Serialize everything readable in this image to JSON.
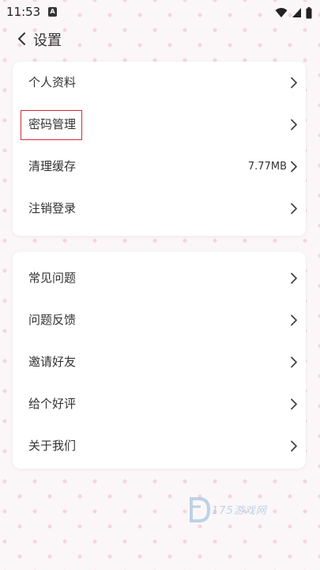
{
  "status_bar": {
    "time": "11:53",
    "notification_glyph": "A",
    "icons": [
      "wifi-icon",
      "cell-signal-icon",
      "battery-icon"
    ]
  },
  "header": {
    "title": "设置",
    "back_icon": "chevron-left-icon"
  },
  "groups": [
    {
      "items": [
        {
          "label": "个人资料"
        },
        {
          "label": "密码管理",
          "highlighted": true
        },
        {
          "label": "清理缓存",
          "value": "7.77MB"
        },
        {
          "label": "注销登录"
        }
      ]
    },
    {
      "items": [
        {
          "label": "常见问题"
        },
        {
          "label": "问题反馈"
        },
        {
          "label": "邀请好友"
        },
        {
          "label": "给个好评"
        },
        {
          "label": "关于我们"
        }
      ]
    }
  ],
  "watermark": {
    "text": "175游戏网"
  },
  "colors": {
    "background": "#fbf7f8",
    "dot": "#f3d7dd",
    "card": "#ffffff",
    "text": "#333333",
    "highlight_border": "#d92b3b"
  }
}
